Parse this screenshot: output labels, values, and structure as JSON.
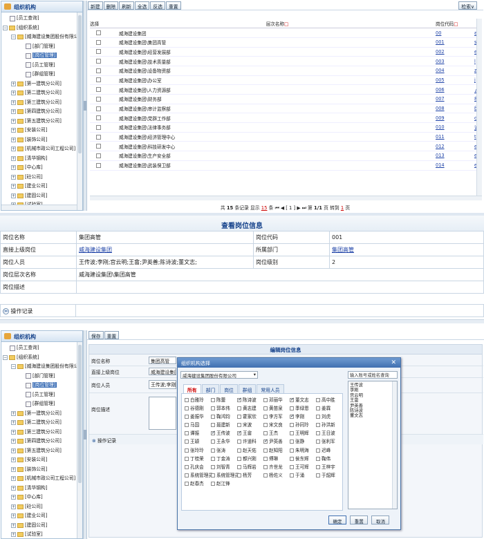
{
  "top": {
    "tree": {
      "title": "组织机构",
      "nodes": [
        {
          "label": "[员工查询]",
          "level": 0,
          "type": "doc",
          "sel": false
        },
        {
          "label": "[组织系统]",
          "level": 0,
          "type": "folder",
          "toggle": "−",
          "sel": false
        },
        {
          "label": "[威海建设集团股份有限公",
          "level": 1,
          "type": "folder",
          "toggle": "−",
          "sel": false
        },
        {
          "label": "[部门管理]",
          "level": 2,
          "type": "doc",
          "sel": false
        },
        {
          "label": "[岗位管理]",
          "level": 2,
          "type": "doc",
          "sel": true
        },
        {
          "label": "[员工管理]",
          "level": 2,
          "type": "doc",
          "sel": false
        },
        {
          "label": "[群组管理]",
          "level": 2,
          "type": "doc",
          "sel": false
        },
        {
          "label": "[第一建筑分公司]",
          "level": 1,
          "type": "folder",
          "toggle": "+",
          "sel": false
        },
        {
          "label": "[第二建筑分公司]",
          "level": 1,
          "type": "folder",
          "toggle": "+",
          "sel": false
        },
        {
          "label": "[第三建筑分公司]",
          "level": 1,
          "type": "folder",
          "toggle": "+",
          "sel": false
        },
        {
          "label": "[第四建筑分公司]",
          "level": 1,
          "type": "folder",
          "toggle": "+",
          "sel": false
        },
        {
          "label": "[第五建筑分公司]",
          "level": 1,
          "type": "folder",
          "toggle": "+",
          "sel": false
        },
        {
          "label": "[安装公司]",
          "level": 1,
          "type": "folder",
          "toggle": "+",
          "sel": false
        },
        {
          "label": "[装饰公司]",
          "level": 1,
          "type": "folder",
          "toggle": "+",
          "sel": false
        },
        {
          "label": "[机械市政公司工程公司]",
          "level": 1,
          "type": "folder",
          "toggle": "+",
          "sel": false
        },
        {
          "label": "[清华钢构]",
          "level": 1,
          "type": "folder",
          "toggle": "+",
          "sel": false
        },
        {
          "label": "[中心库]",
          "level": 1,
          "type": "folder",
          "toggle": "+",
          "sel": false
        },
        {
          "label": "[砼公司]",
          "level": 1,
          "type": "folder",
          "toggle": "+",
          "sel": false
        },
        {
          "label": "[建业公司]",
          "level": 1,
          "type": "folder",
          "toggle": "+",
          "sel": false
        },
        {
          "label": "[建固公司]",
          "level": 1,
          "type": "folder",
          "toggle": "+",
          "sel": false
        },
        {
          "label": "[试验室]",
          "level": 1,
          "type": "folder",
          "toggle": "+",
          "sel": false
        }
      ]
    },
    "toolbar": {
      "buttons": [
        "新建",
        "删除",
        "刷新",
        "全选",
        "反选",
        "重置"
      ],
      "search": "检索∨"
    },
    "grid": {
      "headers": {
        "select": "选择",
        "name": "层次名称",
        "code": "岗位代码"
      },
      "rows": [
        {
          "name": "威海建设集团",
          "code": "00"
        },
        {
          "name": "威海建设集团\\集团高管",
          "code": "001"
        },
        {
          "name": "威海建设集团\\经营发展部",
          "code": "002"
        },
        {
          "name": "威海建设集团\\技术质量部",
          "code": "003"
        },
        {
          "name": "威海建设集团\\设备物资部",
          "code": "004"
        },
        {
          "name": "威海建设集团\\办公室",
          "code": "005"
        },
        {
          "name": "威海建设集团\\人力资源部",
          "code": "006"
        },
        {
          "name": "威海建设集团\\财务部",
          "code": "007"
        },
        {
          "name": "威海建设集团\\审计监察部",
          "code": "008"
        },
        {
          "name": "威海建设集团\\党群工作部",
          "code": "009"
        },
        {
          "name": "威海建设集团\\法律事务部",
          "code": "010"
        },
        {
          "name": "威海建设集团\\经济管理中心",
          "code": "011"
        },
        {
          "name": "威海建设集团\\科技研发中心",
          "code": "012"
        },
        {
          "name": "威海建设集团\\生产安全部",
          "code": "013"
        },
        {
          "name": "威海建设集团\\武装保卫部",
          "code": "014"
        }
      ],
      "extra_col": [
        "ɛ",
        "s",
        "e",
        "l",
        "z",
        "j",
        "ㄥ",
        "8",
        "ɓ",
        "o",
        "沪",
        "t",
        "e",
        "e",
        "e"
      ]
    },
    "pager": {
      "pre": "共",
      "total": "15",
      "mid1": "条记录 显示",
      "size": "15",
      "mid2": "条",
      "nav": "⏮ ◀ [ 1 ] ▶ ⏭",
      "page_label": "第",
      "page": "1/1",
      "page_suffix": "页 转到",
      "goto": "1",
      "tail": "页"
    }
  },
  "view": {
    "title": "查看岗位信息",
    "fields": {
      "l1": "岗位名称",
      "v1": "集团高管",
      "l2": "岗位代码",
      "v2": "001",
      "l3": "直接上级岗位",
      "v3": "威海建设集团",
      "l4": "所属部门",
      "v4": "集团高管",
      "l5": "岗位人员",
      "v5": "王传波;李刚;宫云明;王畲;尹英善;陈诗波;董文志;",
      "l6": "岗位级别",
      "v6": "2",
      "l7": "岗位层次名称",
      "v7": "威海建设集团\\集团高管",
      "l8": "岗位描述"
    },
    "log": "操作记录"
  },
  "edit": {
    "tree": {
      "title": "组织机构"
    },
    "toolbar": {
      "buttons": [
        "保存",
        "重置"
      ]
    },
    "title": "编辑岗位信息",
    "form": {
      "l1": "岗位名称",
      "v1": "集团高管",
      "l2": "直接上级岗位",
      "v2": "威海建设集团",
      "l3": "岗位人员",
      "v3": "王传波;李刚",
      "l4": "岗位描述",
      "log": "操作记录"
    },
    "modal": {
      "title": "组织机构选择",
      "org_select": "威海建设集团股份有限公司",
      "search_placeholder": "输入账号或姓名查询",
      "tabs": [
        "所有",
        "部门",
        "岗位",
        "群组",
        "常用人员"
      ],
      "people": [
        {
          "n": "白雅玲",
          "c": false
        },
        {
          "n": "陈蕾",
          "c": false
        },
        {
          "n": "陈诗波",
          "c": true
        },
        {
          "n": "邓丽华",
          "c": false
        },
        {
          "n": "董文志",
          "c": true
        },
        {
          "n": "高中胜",
          "c": false
        },
        {
          "n": "谷德刚",
          "c": false
        },
        {
          "n": "郭本伟",
          "c": false
        },
        {
          "n": "黄志建",
          "c": false
        },
        {
          "n": "黄苗泉",
          "c": false
        },
        {
          "n": "季绿恩",
          "c": false
        },
        {
          "n": "姜霖",
          "c": false
        },
        {
          "n": "姜振华",
          "c": false
        },
        {
          "n": "鞠鸿钧",
          "c": false
        },
        {
          "n": "霍家欣",
          "c": false
        },
        {
          "n": "李方军",
          "c": false
        },
        {
          "n": "李刚",
          "c": true
        },
        {
          "n": "刘虎",
          "c": false
        },
        {
          "n": "马国",
          "c": false
        },
        {
          "n": "聂建新",
          "c": false
        },
        {
          "n": "宋波",
          "c": false
        },
        {
          "n": "宋文良",
          "c": false
        },
        {
          "n": "孙同玲",
          "c": false
        },
        {
          "n": "孙洪新",
          "c": false
        },
        {
          "n": "谭振",
          "c": false
        },
        {
          "n": "王传波",
          "c": true
        },
        {
          "n": "王畲",
          "c": true
        },
        {
          "n": "王杰",
          "c": false
        },
        {
          "n": "王明辉",
          "c": false
        },
        {
          "n": "王日波",
          "c": false
        },
        {
          "n": "王颖",
          "c": false
        },
        {
          "n": "王永华",
          "c": false
        },
        {
          "n": "许道科",
          "c": false
        },
        {
          "n": "尹英善",
          "c": true
        },
        {
          "n": "张静",
          "c": false
        },
        {
          "n": "张利军",
          "c": false
        },
        {
          "n": "张玲玲",
          "c": false
        },
        {
          "n": "张涛",
          "c": false
        },
        {
          "n": "赵天佑",
          "c": false
        },
        {
          "n": "赵知阳",
          "c": false
        },
        {
          "n": "朱明海",
          "c": false
        },
        {
          "n": "迟峰",
          "c": false
        },
        {
          "n": "丁桂荣",
          "c": false
        },
        {
          "n": "丁金涛",
          "c": false
        },
        {
          "n": "都兴刚",
          "c": false
        },
        {
          "n": "傅琳",
          "c": false
        },
        {
          "n": "侯东辉",
          "c": false
        },
        {
          "n": "鞠伟",
          "c": false
        },
        {
          "n": "孔庆会",
          "c": false
        },
        {
          "n": "刘智青",
          "c": false
        },
        {
          "n": "马辉岩",
          "c": false
        },
        {
          "n": "齐世龙",
          "c": false
        },
        {
          "n": "王可辉",
          "c": false
        },
        {
          "n": "王梓宇",
          "c": false
        },
        {
          "n": "系统管理员",
          "c": false
        },
        {
          "n": "系统管理员",
          "c": false
        },
        {
          "n": "杨芳",
          "c": false
        },
        {
          "n": "杨佐义",
          "c": false
        },
        {
          "n": "于涌",
          "c": false
        },
        {
          "n": "于韶辉",
          "c": false
        },
        {
          "n": "赵春杰",
          "c": false
        },
        {
          "n": "赵江锋",
          "c": false
        }
      ],
      "selected": [
        "王传波",
        "李刚",
        "宫云明",
        "王畲",
        "尹英善",
        "陈诗波",
        "董文志"
      ],
      "buttons": {
        "ok": "确定",
        "reset": "重置",
        "cancel": "取消"
      }
    }
  }
}
